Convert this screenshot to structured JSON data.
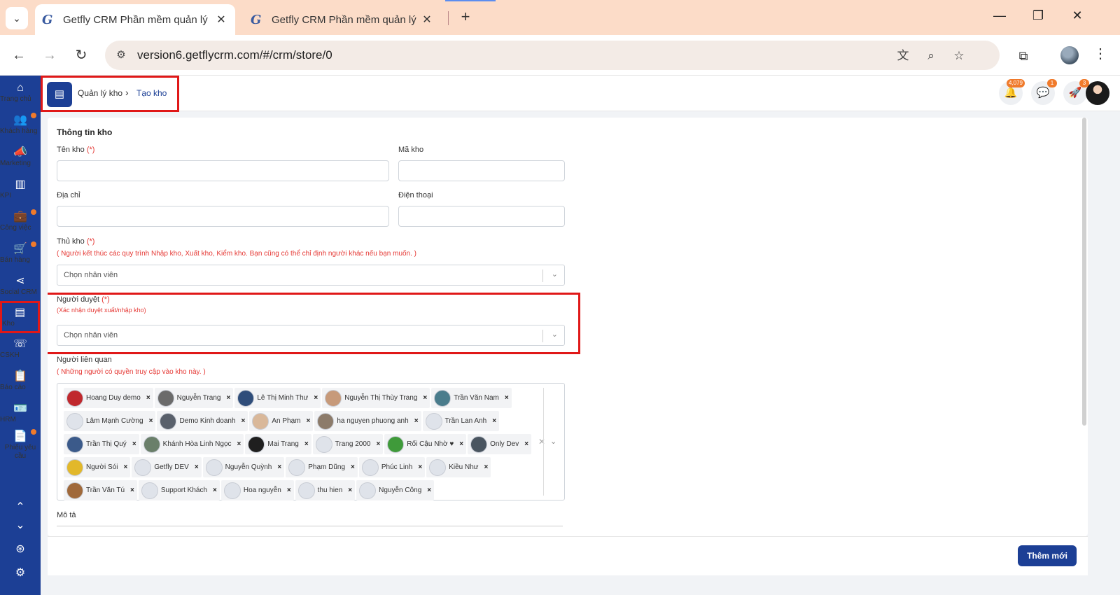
{
  "browser": {
    "tabs": [
      {
        "title": "Getfly CRM Phần mềm quản lý",
        "favicon": "G"
      },
      {
        "title": "Getfly CRM Phần mềm quản lý",
        "favicon": "G"
      }
    ],
    "url": "version6.getflycrm.com/#/crm/store/0"
  },
  "sidebar": {
    "items": [
      {
        "label": "Trang chủ",
        "icon": "home-icon",
        "glyph": "⌂",
        "dot": false
      },
      {
        "label": "Khách hàng",
        "icon": "users-icon",
        "glyph": "👥",
        "dot": true
      },
      {
        "label": "Marketing",
        "icon": "megaphone-icon",
        "glyph": "📣",
        "dot": false
      },
      {
        "label": "KPI",
        "icon": "chart-icon",
        "glyph": "▥",
        "dot": false
      },
      {
        "label": "Công việc",
        "icon": "briefcase-icon",
        "glyph": "💼",
        "dot": true
      },
      {
        "label": "Bán hàng",
        "icon": "cart-icon",
        "glyph": "🛒",
        "dot": true
      },
      {
        "label": "Social CRM",
        "icon": "share-icon",
        "glyph": "⋖",
        "dot": false
      },
      {
        "label": "Kho",
        "icon": "warehouse-icon",
        "glyph": "▤",
        "dot": false
      },
      {
        "label": "CSKH",
        "icon": "phone-icon",
        "glyph": "☏",
        "dot": false
      },
      {
        "label": "Báo cáo",
        "icon": "clipboard-icon",
        "glyph": "📋",
        "dot": false
      },
      {
        "label": "HRM",
        "icon": "id-card-icon",
        "glyph": "🪪",
        "dot": false
      },
      {
        "label": "Phiếu yêu cầu",
        "icon": "document-icon",
        "glyph": "📄",
        "dot": true
      }
    ]
  },
  "header": {
    "breadcrumb_parent": "Quản lý kho",
    "breadcrumb_current": "Tạo kho",
    "notifications_count": "4,079",
    "messages_count": "1",
    "rocket_count": "3"
  },
  "form": {
    "section_title": "Thông tin kho",
    "name_label": "Tên kho",
    "code_label": "Mã kho",
    "address_label": "Địa chỉ",
    "phone_label": "Điện thoại",
    "required_mark": "(*)",
    "keeper_label": "Thủ kho",
    "keeper_hint": "( Người kết thúc các quy trình Nhập kho, Xuất kho, Kiểm kho. Bạn cũng có thể chỉ định người khác nếu bạn muốn. )",
    "keeper_placeholder": "Chọn nhân viên",
    "approver_label": "Người duyệt",
    "approver_hint": "(Xác nhận duyệt xuất/nhập kho)",
    "approver_placeholder": "Chọn nhân viên",
    "related_label": "Người liên quan",
    "related_hint": "( Những người có quyền truy cập vào kho này. )",
    "related_people": [
      "Hoang Duy demo",
      "Nguyễn Trang",
      "Lê Thị Minh Thư",
      "Nguyễn Thị Thùy Trang",
      "Trần Văn Nam",
      "Lâm Mạnh Cường",
      "Demo Kinh doanh",
      "An Phạm",
      "ha nguyen phuong anh",
      "Trần Lan Anh",
      "Trần Thị Quý",
      "Khánh Hòa Linh Ngọc",
      "Mai Trang",
      "Trang 2000",
      "Rối Cậu Nhờ ♥",
      "Only Dev",
      "Người Sói",
      "Getfly DEV",
      "Nguyễn Quỳnh",
      "Phạm Dũng",
      "Phúc Linh",
      "Kiều Như",
      "Trần Văn Tú",
      "Support Khách",
      "Hoa nguyễn",
      "thu hien",
      "Nguyễn Công"
    ],
    "description_label": "Mô tả"
  },
  "footer": {
    "add_button": "Thêm mới"
  },
  "colors": {
    "brand": "#1c3f95",
    "accent": "#f07a2b",
    "required": "#e53935",
    "highlight": "#e01818"
  }
}
